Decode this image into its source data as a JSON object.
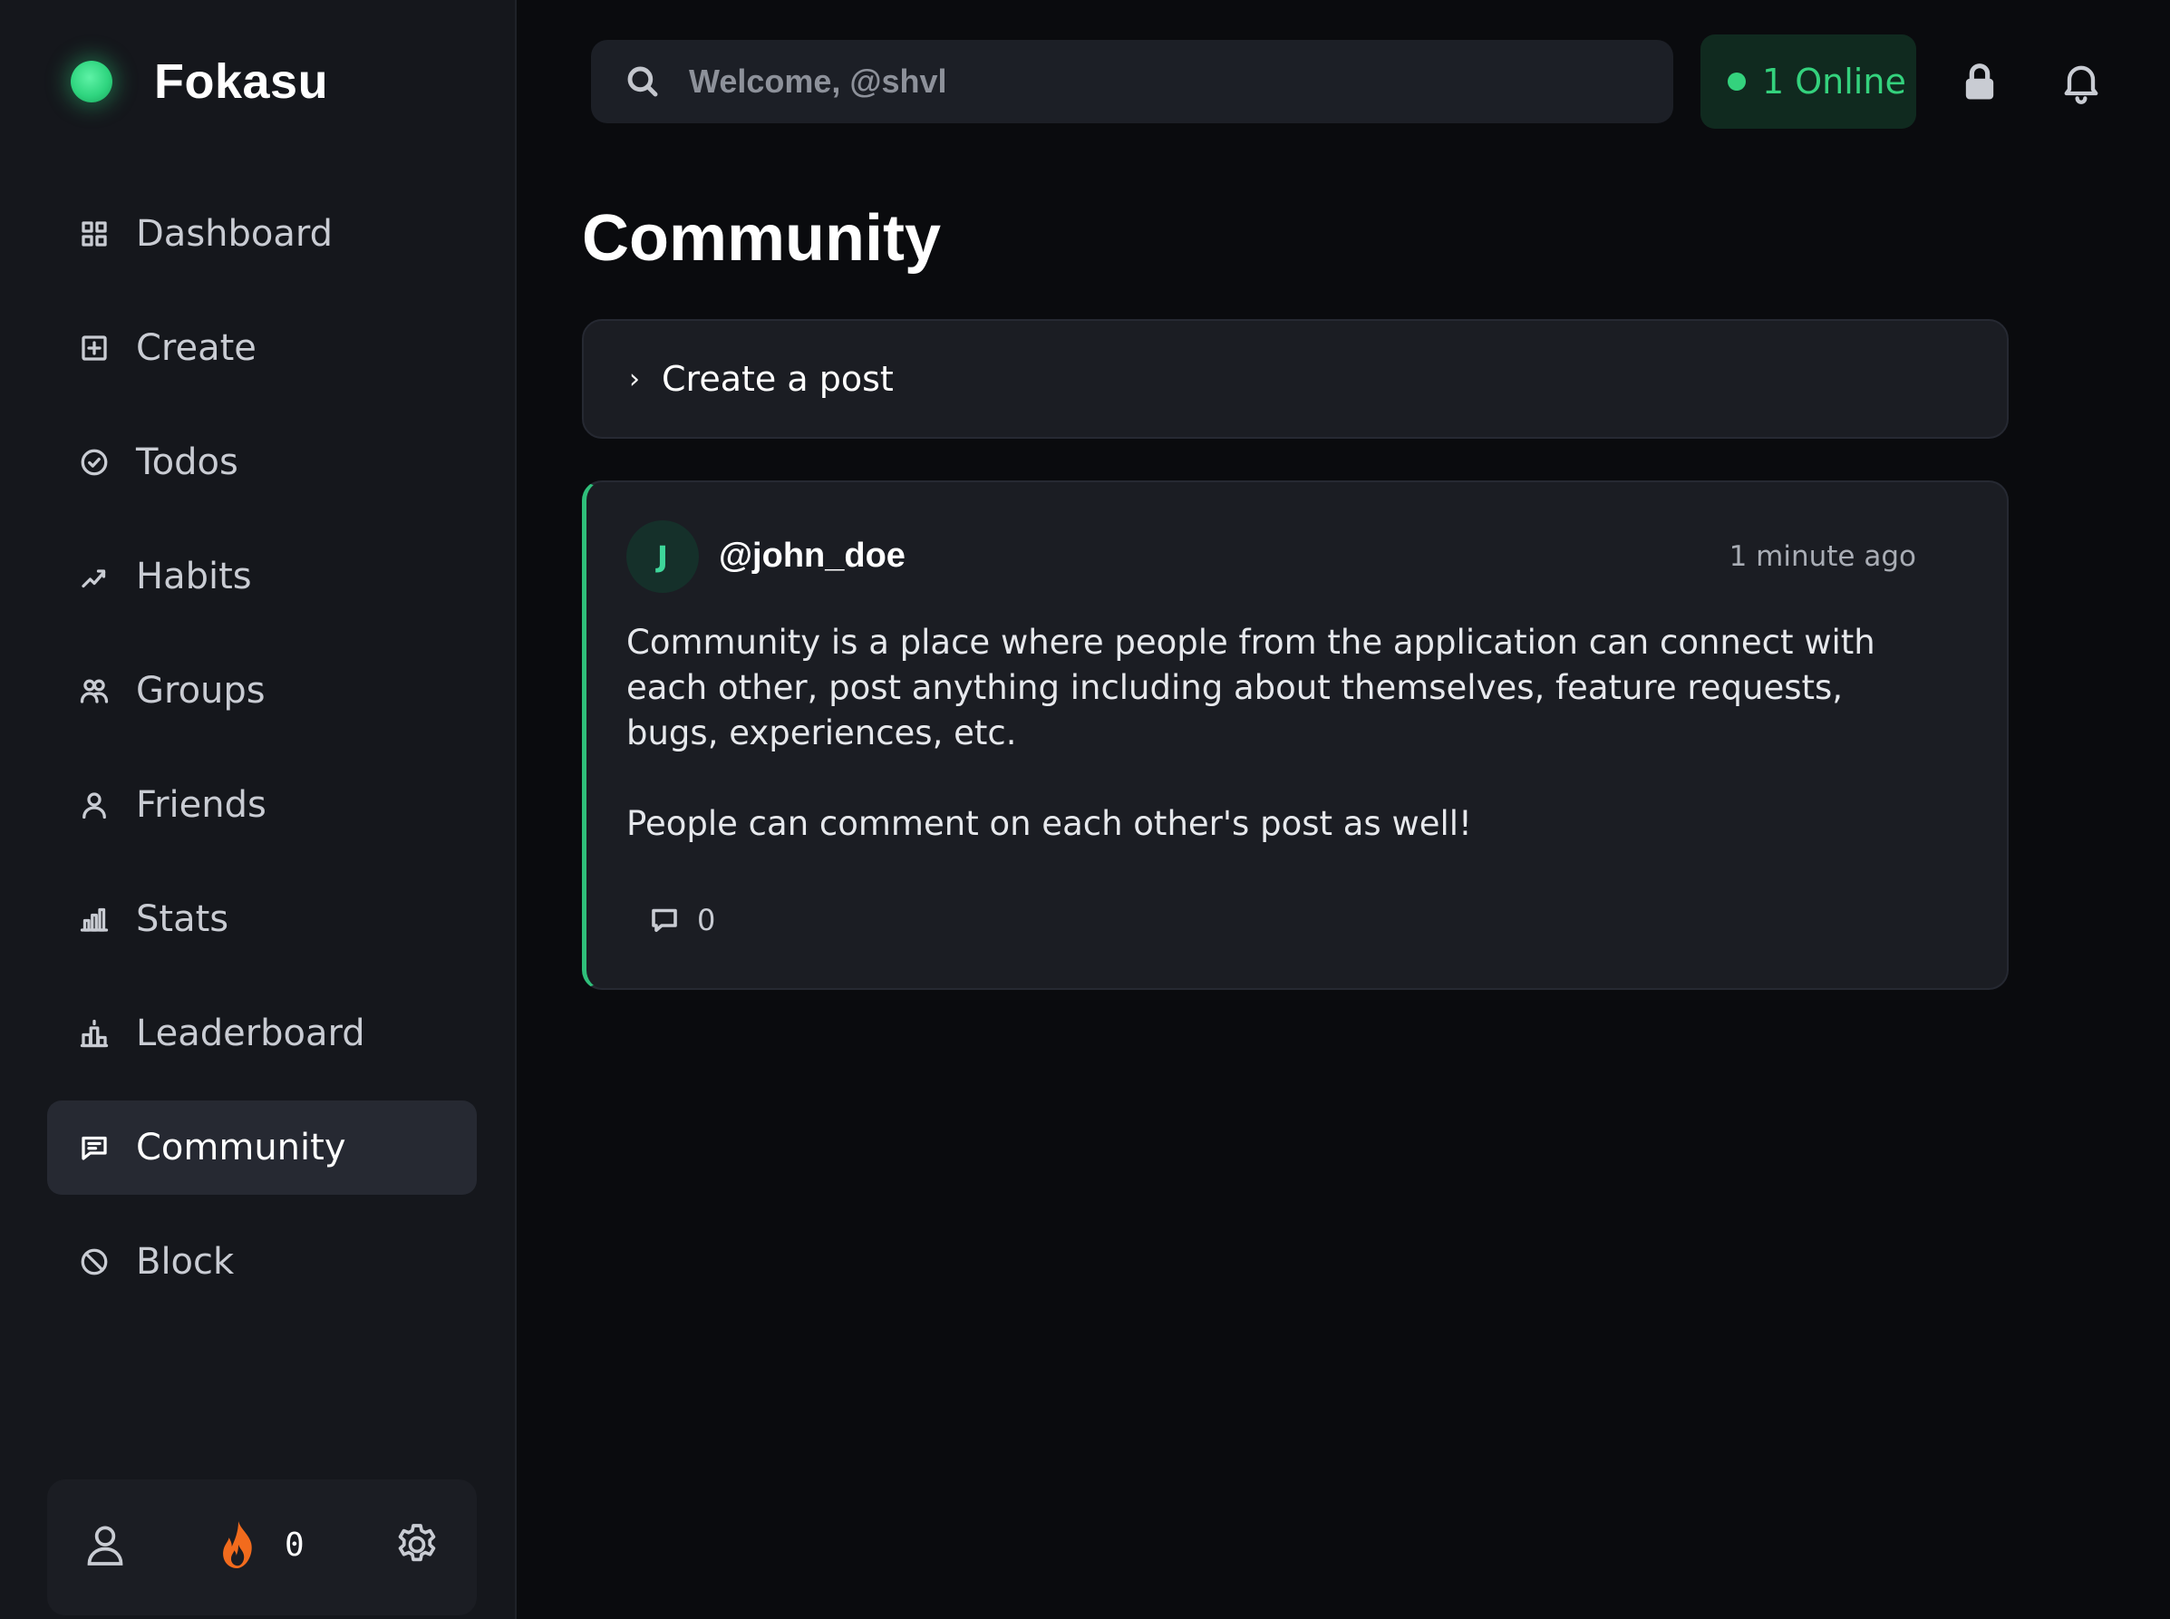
{
  "brand": {
    "name": "Fokasu",
    "color": "#2fd57f"
  },
  "sidebar": {
    "items": [
      {
        "label": "Dashboard",
        "icon": "grid-icon",
        "active": false
      },
      {
        "label": "Create",
        "icon": "plus-square-icon",
        "active": false
      },
      {
        "label": "Todos",
        "icon": "check-circle-icon",
        "active": false
      },
      {
        "label": "Habits",
        "icon": "trend-icon",
        "active": false
      },
      {
        "label": "Groups",
        "icon": "users-icon",
        "active": false
      },
      {
        "label": "Friends",
        "icon": "user-icon",
        "active": false
      },
      {
        "label": "Stats",
        "icon": "bar-chart-icon",
        "active": false
      },
      {
        "label": "Leaderboard",
        "icon": "podium-icon",
        "active": false
      },
      {
        "label": "Community",
        "icon": "message-square-icon",
        "active": true
      },
      {
        "label": "Block",
        "icon": "ban-icon",
        "active": false
      }
    ],
    "footer": {
      "streak_count": "0",
      "streak_icon": "flame-icon",
      "profile_icon": "user-icon",
      "settings_icon": "gear-icon"
    }
  },
  "topbar": {
    "search_placeholder": "Welcome, @shvl",
    "online_label": "1 Online",
    "online_color": "#34d27d"
  },
  "main": {
    "title": "Community",
    "create_post_label": "Create a post",
    "posts": [
      {
        "avatar_initial": "J",
        "username": "@john_doe",
        "time": "1 minute ago",
        "body_paragraph_1": "Community is a place where people from the application can connect with each other, post anything including about themselves, feature requests, bugs, experiences, etc.",
        "body_paragraph_2": "People can comment on each other's post as well!",
        "comment_count": "0",
        "accent_color": "#2fbf7a"
      }
    ]
  }
}
